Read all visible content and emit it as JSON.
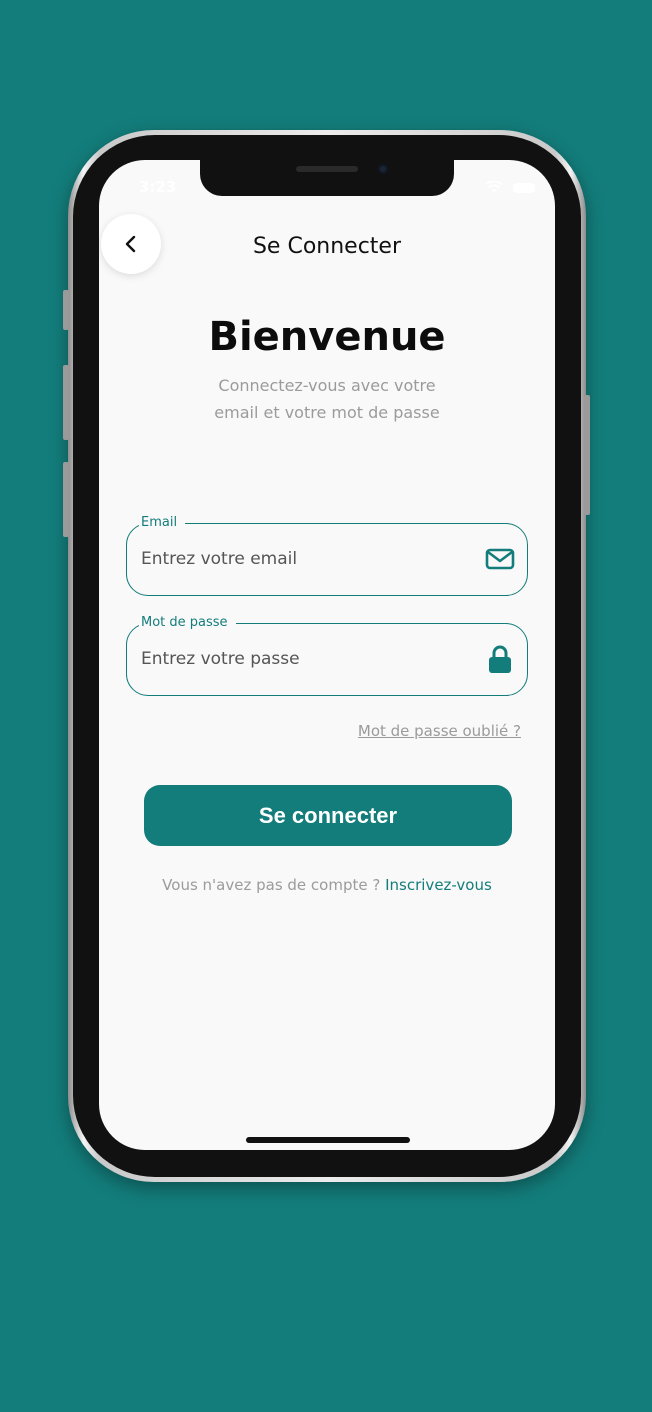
{
  "status": {
    "time": "3:23"
  },
  "header": {
    "title": "Se Connecter"
  },
  "welcome": {
    "heading": "Bienvenue",
    "subtitle_line1": "Connectez-vous avec votre",
    "subtitle_line2": "email et votre mot de passe"
  },
  "form": {
    "email": {
      "label": "Email",
      "placeholder": "Entrez votre email",
      "icon": "envelope-icon"
    },
    "password": {
      "label": "Mot de passe",
      "placeholder": "Entrez votre passe",
      "icon": "lock-icon"
    },
    "forgot": "Mot de passe oublié ?",
    "submit": "Se connecter"
  },
  "footer": {
    "prompt": "Vous n'avez pas de compte ?",
    "link": "Inscrivez-vous"
  },
  "colors": {
    "accent": "#137d7b",
    "background": "#f9f9f9",
    "muted": "#9b9b9b"
  }
}
